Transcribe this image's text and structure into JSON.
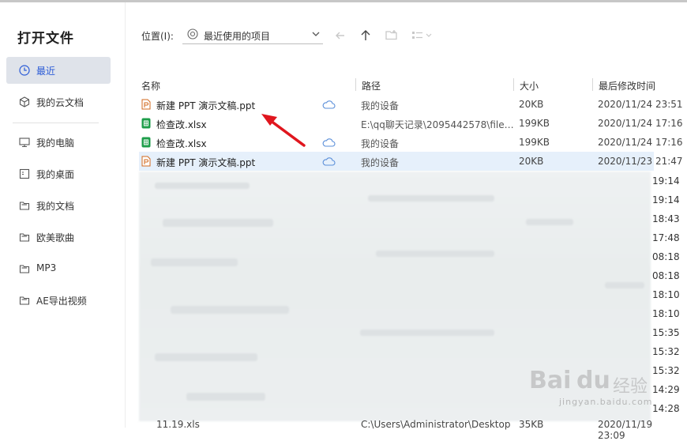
{
  "app": {
    "title": "打开文件"
  },
  "sidebar": {
    "items": [
      {
        "label": "最近",
        "icon": "clock-icon",
        "active": true
      },
      {
        "label": "我的云文档",
        "icon": "cloud-box-icon"
      },
      {
        "label": "我的电脑",
        "icon": "monitor-icon"
      },
      {
        "label": "我的桌面",
        "icon": "desktop-icon"
      },
      {
        "label": "我的文档",
        "icon": "folder-icon"
      },
      {
        "label": "欧美歌曲",
        "icon": "folder-icon"
      },
      {
        "label": "MP3",
        "icon": "folder-icon"
      },
      {
        "label": "AE导出视频",
        "icon": "folder-icon"
      }
    ]
  },
  "location": {
    "label": "位置(I):",
    "value": "最近使用的项目"
  },
  "toolbar": {
    "icons": [
      "back-arrow-icon",
      "up-arrow-icon",
      "new-folder-icon",
      "view-mode-icon"
    ]
  },
  "table": {
    "headers": {
      "name": "名称",
      "path": "路径",
      "size": "大小",
      "modified": "最后修改时间"
    },
    "rows": [
      {
        "name": "新建 PPT 演示文稿.ppt",
        "type": "ppt",
        "cloud": true,
        "path": "我的设备",
        "size": "20KB",
        "modified": "2020/11/24 23:51"
      },
      {
        "name": "检查改.xlsx",
        "type": "xlsx",
        "cloud": false,
        "path": "E:\\qq聊天记录\\2095442578\\filer...",
        "size": "199KB",
        "modified": "2020/11/24 17:16"
      },
      {
        "name": "检查改.xlsx",
        "type": "xlsx",
        "cloud": true,
        "path": "我的设备",
        "size": "199KB",
        "modified": "2020/11/24 17:16"
      },
      {
        "name": "新建 PPT 演示文稿.ppt",
        "type": "ppt",
        "cloud": true,
        "path": "我的设备",
        "size": "20KB",
        "modified": "2020/11/23 21:47",
        "selected": true
      }
    ],
    "blurred_times": [
      "19:14",
      "19:14",
      "18:43",
      "17:48",
      "08:18",
      "08:18",
      "18:10",
      "18:10",
      "15:35",
      "15:32",
      "15:32",
      "14:29",
      "14:28"
    ],
    "bottom_row": {
      "name": "11.19.xls",
      "path": "C:\\Users\\Administrator\\Desktop",
      "size": "35KB",
      "modified": "2020/11/19 23:09"
    }
  },
  "colors": {
    "accent": "#2b5bd7",
    "selected_row": "#e6f0fb",
    "active_nav": "#dfe3ea",
    "arrow": "#e0161e"
  },
  "watermark": {
    "brand": "Bai",
    "paw": "du",
    "cn": "经验",
    "url": "jingyan.baidu.com"
  }
}
